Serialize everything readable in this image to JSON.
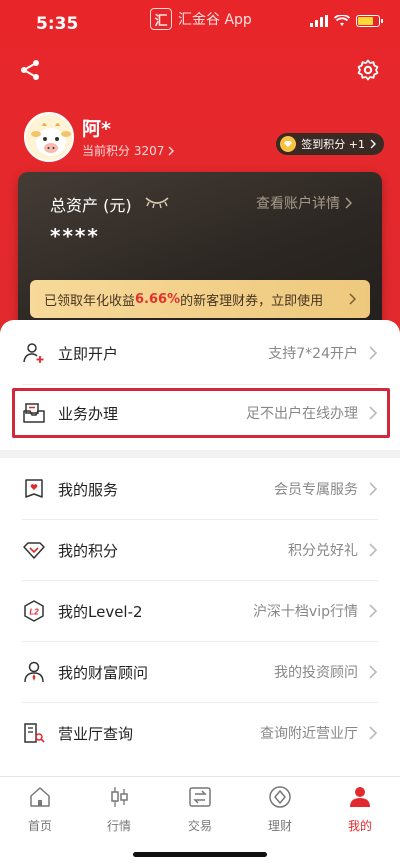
{
  "status_bar": {
    "time": "5:35",
    "app_logo": "汇",
    "app_name": "汇金谷 App"
  },
  "profile": {
    "name": "阿*",
    "points_label": "当前积分 3207",
    "checkin_label": "签到积分 +1"
  },
  "asset_card": {
    "title": "总资产 (元)",
    "value": "****",
    "detail_link": "查看账户详情",
    "promo_prefix": "已领取年化收益",
    "promo_rate": "6.66%",
    "promo_suffix": "的新客理财券，立即使用"
  },
  "top_rows": [
    {
      "label": "立即开户",
      "desc": "支持7*24开户",
      "icon": "person-add-icon"
    },
    {
      "label": "业务办理",
      "desc": "足不出户在线办理",
      "icon": "inbox-icon"
    }
  ],
  "main_rows": [
    {
      "label": "我的服务",
      "desc": "会员专属服务",
      "icon": "service-icon"
    },
    {
      "label": "我的积分",
      "desc": "积分兑好礼",
      "icon": "diamond-icon"
    },
    {
      "label": "我的Level-2",
      "desc": "沪深十档vip行情",
      "icon": "level2-icon"
    },
    {
      "label": "我的财富顾问",
      "desc": "我的投资顾问",
      "icon": "advisor-icon"
    },
    {
      "label": "营业厅查询",
      "desc": "查询附近营业厅",
      "icon": "building-icon"
    }
  ],
  "tabs": [
    {
      "label": "首页",
      "icon": "home-icon"
    },
    {
      "label": "行情",
      "icon": "candlestick-icon"
    },
    {
      "label": "交易",
      "icon": "exchange-icon"
    },
    {
      "label": "理财",
      "icon": "wealth-icon"
    },
    {
      "label": "我的",
      "icon": "user-icon"
    }
  ],
  "colors": {
    "brand_red": "#e12a2e",
    "highlight": "#d2283c",
    "gold": "#eec97d"
  }
}
